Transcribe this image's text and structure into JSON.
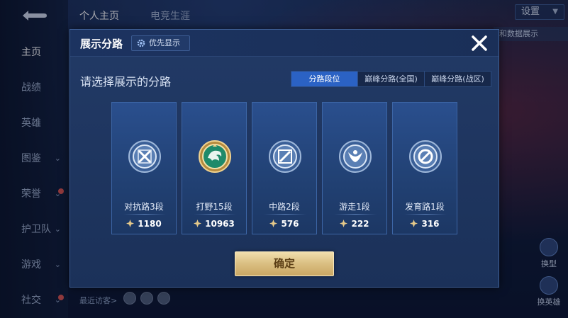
{
  "background": {
    "top_tabs": [
      "个人主页",
      "电竞生涯"
    ],
    "settings_label": "设置",
    "pill_text": "和数据展示",
    "nav": [
      {
        "label": "主页",
        "active": true,
        "chevron": false,
        "dot": false
      },
      {
        "label": "战绩",
        "active": false,
        "chevron": false,
        "dot": false
      },
      {
        "label": "英雄",
        "active": false,
        "chevron": false,
        "dot": false
      },
      {
        "label": "图鉴",
        "active": false,
        "chevron": true,
        "dot": false
      },
      {
        "label": "荣誉",
        "active": false,
        "chevron": true,
        "dot": true
      },
      {
        "label": "护卫队",
        "active": false,
        "chevron": true,
        "dot": false
      },
      {
        "label": "游戏",
        "active": false,
        "chevron": true,
        "dot": false
      },
      {
        "label": "社交",
        "active": false,
        "chevron": true,
        "dot": true
      }
    ],
    "recent_visitors": "最近访客>",
    "side_buttons": [
      "换型",
      "换英雄"
    ]
  },
  "modal": {
    "title": "展示分路",
    "priority_label": "优先显示",
    "subtitle": "请选择展示的分路",
    "segments": [
      {
        "label": "分路段位",
        "active": true
      },
      {
        "label": "巅峰分路(全国)",
        "active": false
      },
      {
        "label": "巅峰分路(战区)",
        "active": false
      }
    ],
    "lanes": [
      {
        "name": "对抗路3段",
        "score": "1180",
        "emblem": "clash-lane-emblem-icon"
      },
      {
        "name": "打野15段",
        "score": "10963",
        "emblem": "jungle-emblem-icon"
      },
      {
        "name": "中路2段",
        "score": "576",
        "emblem": "mid-lane-emblem-icon"
      },
      {
        "name": "游走1段",
        "score": "222",
        "emblem": "roam-emblem-icon"
      },
      {
        "name": "发育路1段",
        "score": "316",
        "emblem": "farm-lane-emblem-icon"
      }
    ],
    "confirm_label": "确定"
  },
  "colors": {
    "accent_blue": "#2b62c4",
    "confirm_gold": "#dcc185",
    "jungle_green": "#1f8a6a",
    "emblem_silver": "#c7d6ea"
  }
}
